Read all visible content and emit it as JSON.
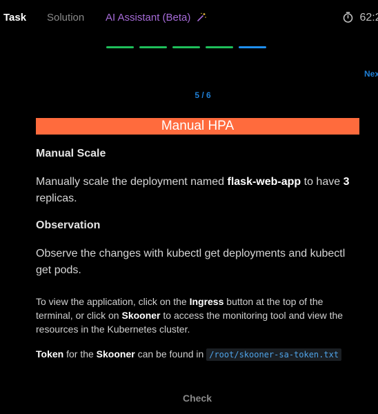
{
  "tabs": {
    "task": "Task",
    "solution": "Solution",
    "ai_assistant": "AI Assistant (Beta)"
  },
  "timer": {
    "text": "62:2"
  },
  "progress": {
    "steps": [
      {
        "state": "done",
        "color": "#1fbf5a"
      },
      {
        "state": "done",
        "color": "#1fbf5a"
      },
      {
        "state": "done",
        "color": "#1fbf5a"
      },
      {
        "state": "done",
        "color": "#1fbf5a"
      },
      {
        "state": "current",
        "color": "#1f8ff0"
      }
    ]
  },
  "nav": {
    "next_label": "Nex",
    "step_counter": "5 / 6"
  },
  "content": {
    "banner_title": "Manual HPA",
    "section1": {
      "heading": "Manual Scale",
      "text_a": "Manually scale the deployment named ",
      "deployment": "flask-web-app",
      "text_b": " to have ",
      "replicas": "3",
      "text_c": " replicas."
    },
    "section2": {
      "heading": "Observation",
      "text": "Observe the changes with kubectl get deployments and kubectl get pods."
    },
    "info": {
      "a": "To view the application, click on the ",
      "ingress": "Ingress",
      "b": " button at the top of the terminal, or click on ",
      "skooner": "Skooner",
      "c": " to access the monitoring tool and view the resources in the Kubernetes cluster."
    },
    "token": {
      "token_word": "Token",
      "a": " for the ",
      "skooner": "Skooner",
      "b": " can be found in ",
      "path": "/root/skooner-sa-token.txt"
    }
  },
  "actions": {
    "check_label": "Check"
  },
  "colors": {
    "banner": "#ff6b3d",
    "accent_blue": "#1f7fd6",
    "ai_purple": "#a66bd8"
  }
}
